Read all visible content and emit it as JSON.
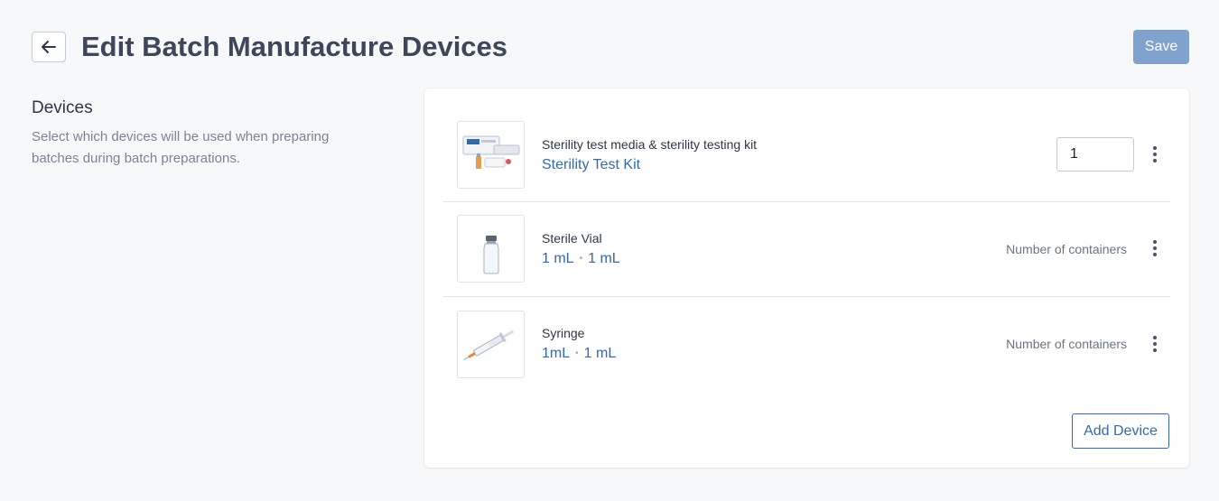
{
  "header": {
    "title": "Edit Batch Manufacture Devices",
    "save_label": "Save"
  },
  "sidebar": {
    "title": "Devices",
    "description": "Select which devices will be used when preparing batches during batch preparations."
  },
  "devices": [
    {
      "name": "Sterility test media & sterility testing kit",
      "sub_primary": "Sterility Test Kit",
      "sub_secondary": "",
      "quantity": "1",
      "containers_label": "",
      "image": "sterility-kit-image"
    },
    {
      "name": "Sterile Vial",
      "sub_primary": "1 mL",
      "sub_secondary": "1 mL",
      "quantity": "",
      "containers_label": "Number of containers",
      "image": "vial-image"
    },
    {
      "name": "Syringe",
      "sub_primary": "1mL",
      "sub_secondary": "1 mL",
      "quantity": "",
      "containers_label": "Number of containers",
      "image": "syringe-image"
    }
  ],
  "actions": {
    "add_device_label": "Add Device"
  },
  "colors": {
    "accent": "#3768a8",
    "save_button": "#7fa3cc",
    "title": "#3d4759"
  }
}
